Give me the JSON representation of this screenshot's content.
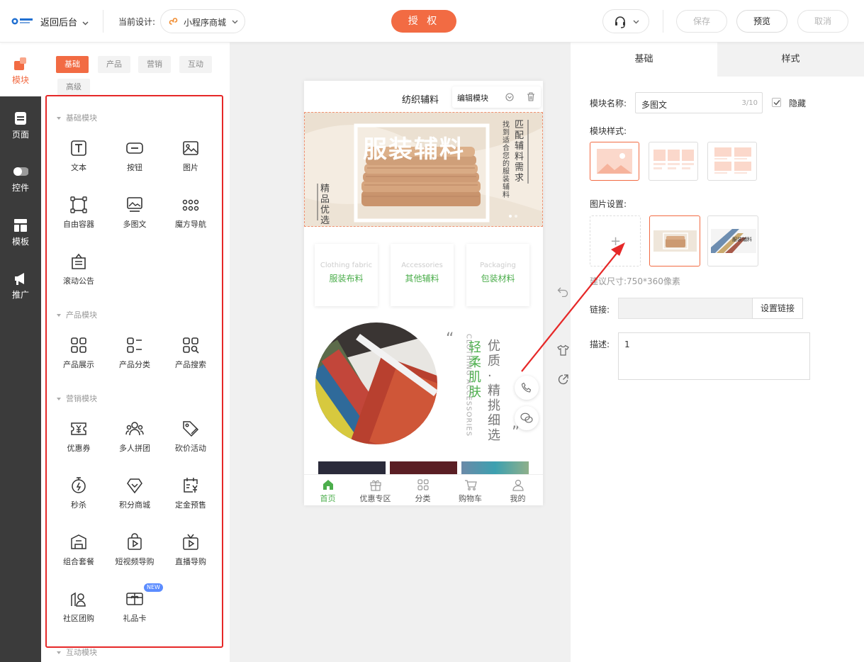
{
  "header": {
    "back_label": "返回后台",
    "current_design_label": "当前设计:",
    "current_design_value": "小程序商城",
    "authorize_label": "授 权",
    "save_label": "保存",
    "preview_label": "预览",
    "cancel_label": "取消"
  },
  "rail": {
    "items": [
      {
        "label": "模块",
        "active": true
      },
      {
        "label": "页面"
      },
      {
        "label": "控件"
      },
      {
        "label": "模板"
      },
      {
        "label": "推广"
      }
    ]
  },
  "palette": {
    "tabs": [
      "基础",
      "产品",
      "营销",
      "互动",
      "高级"
    ],
    "sections": [
      {
        "title": "基础模块",
        "items": [
          "文本",
          "按钮",
          "图片",
          "自由容器",
          "多图文",
          "魔方导航",
          "滚动公告"
        ]
      },
      {
        "title": "产品模块",
        "items": [
          "产品展示",
          "产品分类",
          "产品搜索"
        ]
      },
      {
        "title": "营销模块",
        "items": [
          "优惠券",
          "多人拼团",
          "砍价活动",
          "秒杀",
          "积分商城",
          "定金预售",
          "组合套餐",
          "短视频导购",
          "直播导购",
          "社区团购",
          "礼品卡"
        ]
      },
      {
        "title": "互动模块",
        "items": []
      }
    ],
    "new_badge": "NEW"
  },
  "phone": {
    "title": "纺织辅料",
    "edit_module_label": "编辑模块",
    "banner": {
      "main_text": "服装辅料",
      "side_text_1": "匹配辅料需求",
      "side_text_2": "找到适合您的服装辅料",
      "left_text": "精品优选"
    },
    "categories": [
      {
        "en": "Clothing fabric",
        "zh": "服装布料"
      },
      {
        "en": "Accessories",
        "zh": "其他辅料"
      },
      {
        "en": "Packaging",
        "zh": "包装材料"
      }
    ],
    "feature": {
      "green_text": "轻柔肌肤",
      "gray_text": "优质·精挑细选",
      "en_text": "CLOTHING ACCESSORIES",
      "quote_open": "“",
      "quote_close": "”"
    },
    "tabbar": [
      "首页",
      "优惠专区",
      "分类",
      "购物车",
      "我的"
    ]
  },
  "panel": {
    "tabs": [
      "基础",
      "样式"
    ],
    "module_name_label": "模块名称:",
    "module_name_value": "多图文",
    "module_name_count": "3/10",
    "hide_label": "隐藏",
    "module_style_label": "模块样式:",
    "image_settings_label": "图片设置:",
    "add_symbol": "+",
    "thumb2_text": "服装辅料",
    "size_hint": "建议尺寸:750*360像素",
    "link_label": "链接:",
    "set_link_label": "设置链接",
    "desc_label": "描述:",
    "desc_value": "1"
  },
  "colors": {
    "accent": "#f26b43",
    "highlight": "#e62828",
    "rail_bg": "#3b3b3b",
    "canvas_bg": "#f0f0f0",
    "green": "#4cae4c"
  }
}
